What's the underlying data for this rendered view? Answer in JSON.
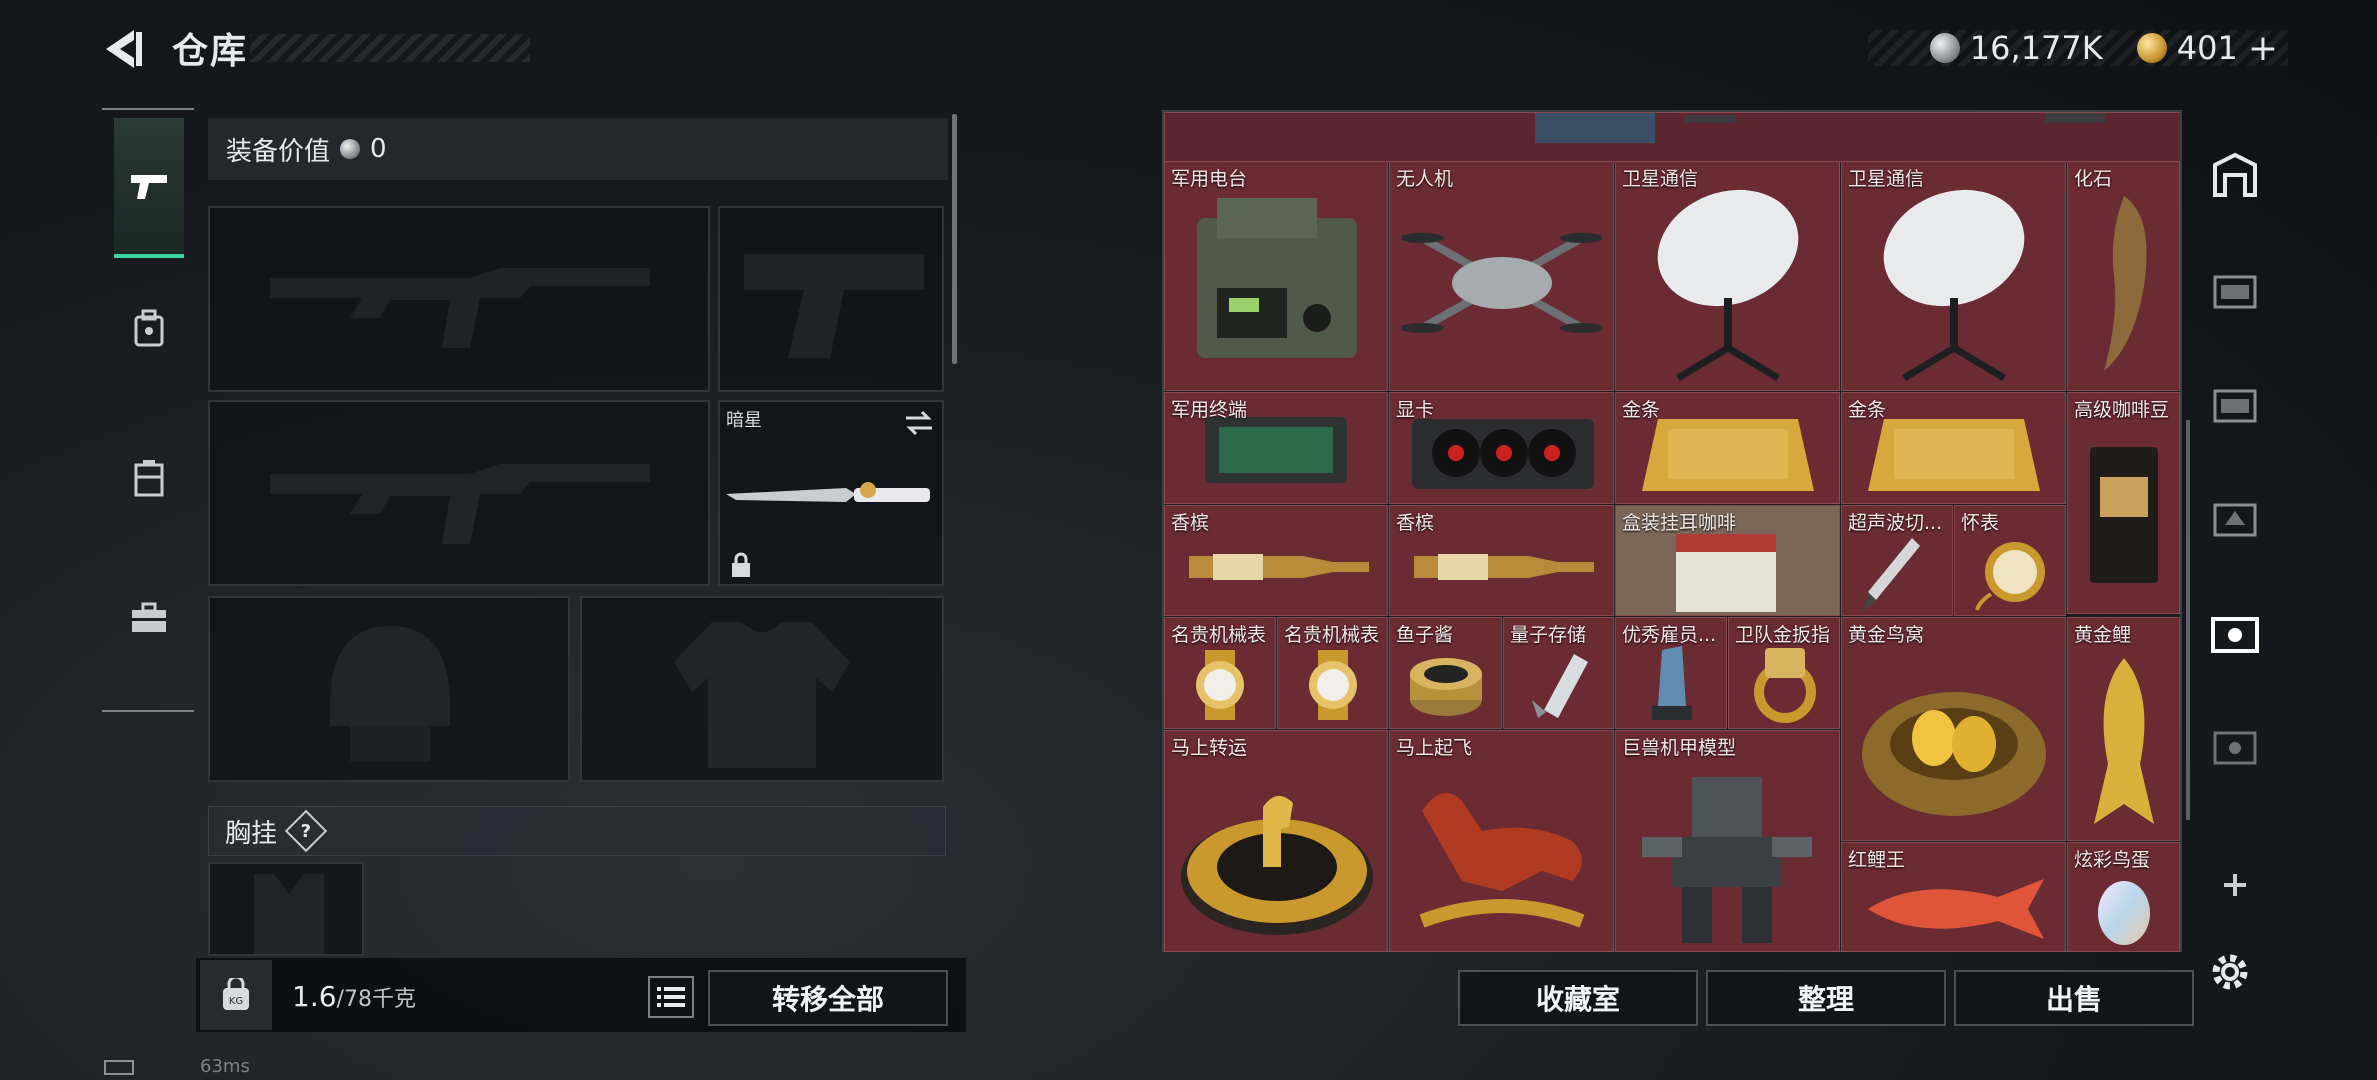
{
  "header": {
    "title": "仓库"
  },
  "currency": {
    "silver": "16,177K",
    "gold": "401",
    "gold_plus": "+"
  },
  "equipment": {
    "value_label": "装备价值",
    "value": "0",
    "melee_name": "暗星",
    "chest_label": "胸挂",
    "chest_help": "?"
  },
  "capacity": {
    "current": "1.6",
    "max": "/78千克"
  },
  "buttons": {
    "transfer_all": "转移全部",
    "collection": "收藏室",
    "organize": "整理",
    "sell": "出售"
  },
  "status": {
    "ping": "63ms"
  },
  "stash_items": [
    {
      "name": "军用电台",
      "icon": "military-radio"
    },
    {
      "name": "无人机",
      "icon": "drone"
    },
    {
      "name": "卫星通信",
      "icon": "satellite-dish"
    },
    {
      "name": "卫星通信",
      "icon": "satellite-dish"
    },
    {
      "name": "化石",
      "icon": "fossil-tooth"
    },
    {
      "name": "军用终端",
      "icon": "military-terminal"
    },
    {
      "name": "显卡",
      "icon": "graphics-card"
    },
    {
      "name": "金条",
      "icon": "gold-bar"
    },
    {
      "name": "金条",
      "icon": "gold-bar"
    },
    {
      "name": "高级咖啡豆",
      "icon": "coffee-bag"
    },
    {
      "name": "香槟",
      "icon": "champagne"
    },
    {
      "name": "香槟",
      "icon": "champagne"
    },
    {
      "name": "盒装挂耳咖啡",
      "icon": "coffee-box"
    },
    {
      "name": "超声波切...",
      "icon": "ultrasonic-cutter"
    },
    {
      "name": "怀表",
      "icon": "pocket-watch"
    },
    {
      "name": "名贵机械表",
      "icon": "luxury-watch"
    },
    {
      "name": "名贵机械表",
      "icon": "luxury-watch"
    },
    {
      "name": "鱼子酱",
      "icon": "caviar-tin"
    },
    {
      "name": "量子存储",
      "icon": "quantum-storage"
    },
    {
      "name": "优秀雇员...",
      "icon": "crystal-trophy"
    },
    {
      "name": "卫队金扳指",
      "icon": "gold-ring"
    },
    {
      "name": "黄金鸟窝",
      "icon": "golden-nest"
    },
    {
      "name": "黄金鲤",
      "icon": "golden-carp"
    },
    {
      "name": "马上转运",
      "icon": "horse-medallion"
    },
    {
      "name": "马上起飞",
      "icon": "red-horse"
    },
    {
      "name": "巨兽机甲模型",
      "icon": "mech-model"
    },
    {
      "name": "红鲤王",
      "icon": "red-carp"
    },
    {
      "name": "炫彩鸟蛋",
      "icon": "iridescent-egg"
    }
  ],
  "colors": {
    "accent": "#3fd3a1",
    "cell": "#6b2b33",
    "cell_border": "#8a4a52"
  }
}
